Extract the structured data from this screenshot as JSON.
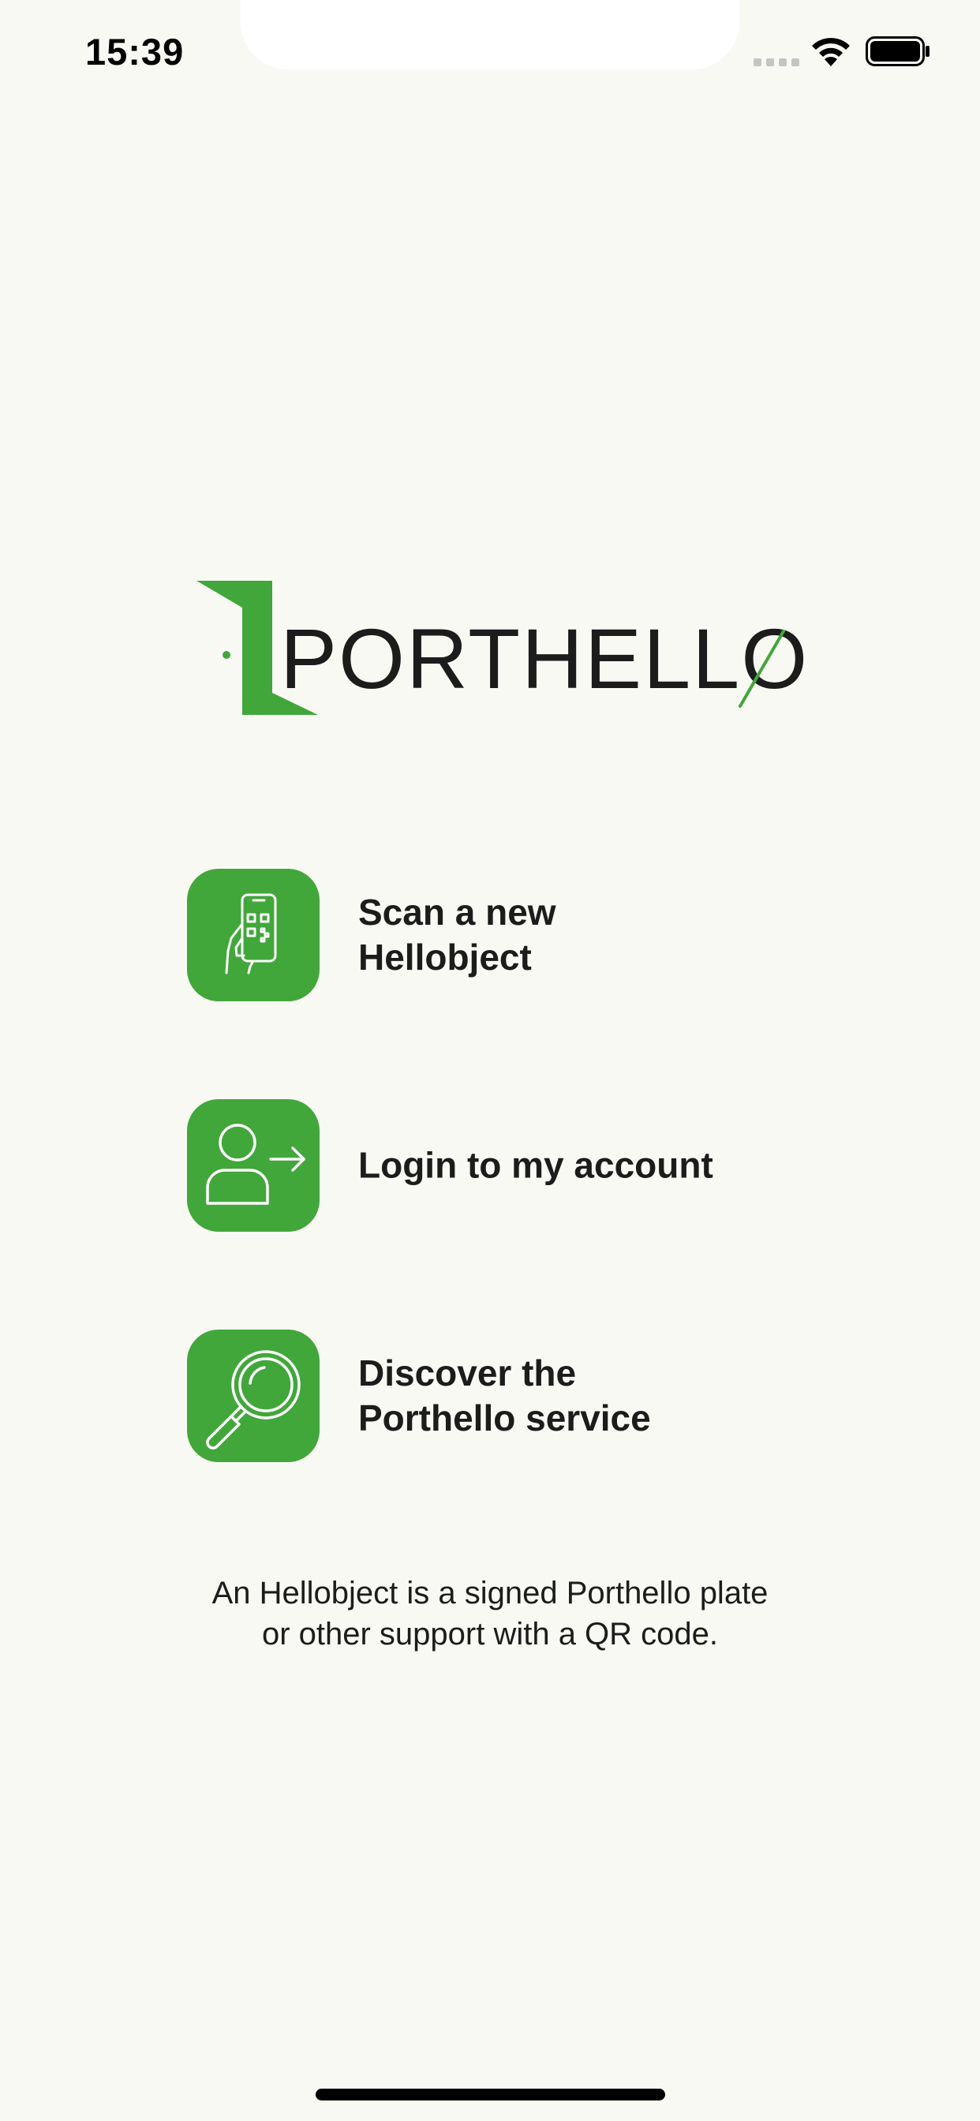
{
  "status_bar": {
    "time": "15:39"
  },
  "brand": {
    "name": "PORTHELLO",
    "accent_color": "#41a73a"
  },
  "menu": [
    {
      "lines": [
        "Scan a new",
        "Hellobject"
      ],
      "icon": "phone-qr-scan-icon"
    },
    {
      "lines": [
        "Login to my account"
      ],
      "icon": "user-login-arrow-icon"
    },
    {
      "lines": [
        "Discover the",
        "Porthello service"
      ],
      "icon": "magnifier-icon"
    }
  ],
  "footnote": {
    "lines": [
      "An Hellobject is a signed Porthello plate",
      "or other support with a QR code."
    ]
  }
}
